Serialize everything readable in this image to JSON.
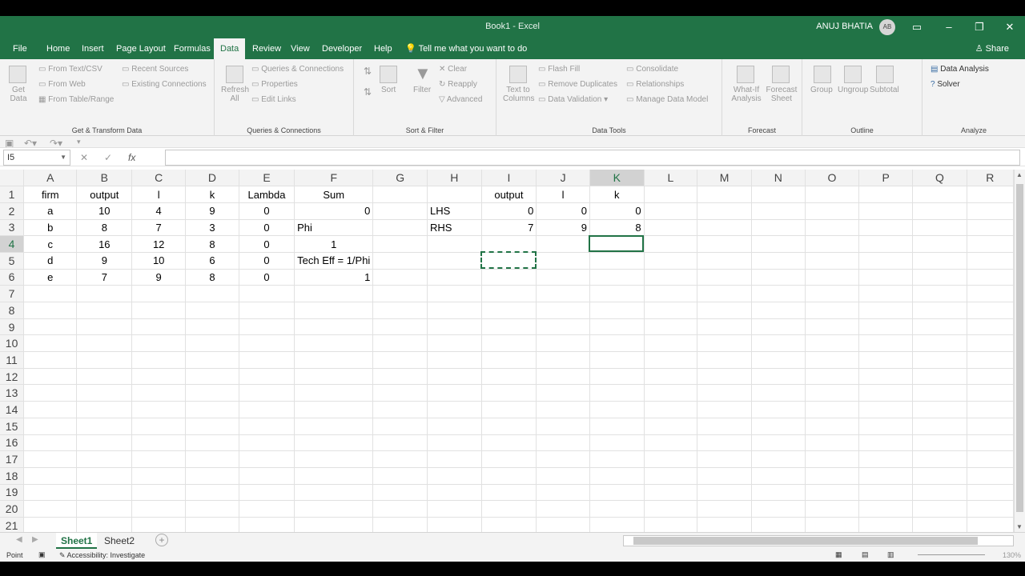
{
  "window": {
    "title": "Book1  -  Excel",
    "user": "ANUJ BHATIA",
    "avatar": "AB"
  },
  "tabs": [
    "File",
    "Home",
    "Insert",
    "Page Layout",
    "Formulas",
    "Data",
    "Review",
    "View",
    "Developer",
    "Help"
  ],
  "active_tab": "Data",
  "tell_me": "Tell me what you want to do",
  "share": "Share",
  "ribbon": {
    "get": {
      "label": "Get & Transform Data",
      "get_data": "Get Data",
      "from_text": "From Text/CSV",
      "from_web": "From Web",
      "from_table": "From Table/Range",
      "recent": "Recent Sources",
      "existing": "Existing Connections"
    },
    "queries": {
      "label": "Queries & Connections",
      "refresh": "Refresh All",
      "qc": "Queries & Connections",
      "props": "Properties",
      "edit": "Edit Links"
    },
    "sort": {
      "label": "Sort & Filter",
      "sort": "Sort",
      "filter": "Filter",
      "clear": "Clear",
      "reapply": "Reapply",
      "advanced": "Advanced"
    },
    "tools": {
      "label": "Data Tools",
      "ttc": "Text to Columns",
      "flash": "Flash Fill",
      "remove": "Remove Duplicates",
      "valid": "Data Validation",
      "consol": "Consolidate",
      "rel": "Relationships",
      "manage": "Manage Data Model"
    },
    "forecast": {
      "label": "Forecast",
      "whatif": "What-If Analysis",
      "sheet": "Forecast Sheet"
    },
    "outline": {
      "label": "Outline",
      "group": "Group",
      "ungroup": "Ungroup",
      "subtotal": "Subtotal"
    },
    "analyze": {
      "label": "Analyze",
      "da": "Data Analysis",
      "solver": "Solver"
    }
  },
  "namebox": "I5",
  "columns": [
    "A",
    "B",
    "C",
    "D",
    "E",
    "F",
    "G",
    "H",
    "I",
    "J",
    "K",
    "L",
    "M",
    "N",
    "O",
    "P",
    "Q",
    "R"
  ],
  "rows": [
    [
      "firm",
      "output",
      "l",
      "k",
      "Lambda",
      "Sum",
      "",
      "",
      "output",
      "l",
      "k",
      "",
      "",
      "",
      "",
      "",
      "",
      ""
    ],
    [
      "a",
      "10",
      "4",
      "9",
      "0",
      "0",
      "",
      "LHS",
      "0",
      "0",
      "0",
      "",
      "",
      "",
      "",
      "",
      "",
      ""
    ],
    [
      "b",
      "8",
      "7",
      "3",
      "0",
      "Phi",
      "",
      "RHS",
      "7",
      "9",
      "8",
      "",
      "",
      "",
      "",
      "",
      "",
      ""
    ],
    [
      "c",
      "16",
      "12",
      "8",
      "0",
      "1",
      "",
      "",
      "",
      "",
      "",
      "",
      "",
      "",
      "",
      "",
      "",
      ""
    ],
    [
      "d",
      "9",
      "10",
      "6",
      "0",
      "Tech Eff = 1/Phi",
      "",
      "",
      "",
      "",
      "",
      "",
      "",
      "",
      "",
      "",
      "",
      ""
    ],
    [
      "e",
      "7",
      "9",
      "8",
      "0",
      "1",
      "",
      "",
      "",
      "",
      "",
      "",
      "",
      "",
      "",
      "",
      "",
      ""
    ],
    [
      "",
      "",
      "",
      "",
      "",
      "",
      "",
      "",
      "",
      "",
      "",
      "",
      "",
      "",
      "",
      "",
      "",
      ""
    ],
    [
      "",
      "",
      "",
      "",
      "",
      "",
      "",
      "",
      "",
      "",
      "",
      "",
      "",
      "",
      "",
      "",
      "",
      ""
    ],
    [
      "",
      "",
      "",
      "",
      "",
      "",
      "",
      "",
      "",
      "",
      "",
      "",
      "",
      "",
      "",
      "",
      "",
      ""
    ],
    [
      "",
      "",
      "",
      "",
      "",
      "",
      "",
      "",
      "",
      "",
      "",
      "",
      "",
      "",
      "",
      "",
      "",
      ""
    ],
    [
      "",
      "",
      "",
      "",
      "",
      "",
      "",
      "",
      "",
      "",
      "",
      "",
      "",
      "",
      "",
      "",
      "",
      ""
    ],
    [
      "",
      "",
      "",
      "",
      "",
      "",
      "",
      "",
      "",
      "",
      "",
      "",
      "",
      "",
      "",
      "",
      "",
      ""
    ],
    [
      "",
      "",
      "",
      "",
      "",
      "",
      "",
      "",
      "",
      "",
      "",
      "",
      "",
      "",
      "",
      "",
      "",
      ""
    ],
    [
      "",
      "",
      "",
      "",
      "",
      "",
      "",
      "",
      "",
      "",
      "",
      "",
      "",
      "",
      "",
      "",
      "",
      ""
    ],
    [
      "",
      "",
      "",
      "",
      "",
      "",
      "",
      "",
      "",
      "",
      "",
      "",
      "",
      "",
      "",
      "",
      "",
      ""
    ],
    [
      "",
      "",
      "",
      "",
      "",
      "",
      "",
      "",
      "",
      "",
      "",
      "",
      "",
      "",
      "",
      "",
      "",
      ""
    ],
    [
      "",
      "",
      "",
      "",
      "",
      "",
      "",
      "",
      "",
      "",
      "",
      "",
      "",
      "",
      "",
      "",
      "",
      ""
    ],
    [
      "",
      "",
      "",
      "",
      "",
      "",
      "",
      "",
      "",
      "",
      "",
      "",
      "",
      "",
      "",
      "",
      "",
      ""
    ],
    [
      "",
      "",
      "",
      "",
      "",
      "",
      "",
      "",
      "",
      "",
      "",
      "",
      "",
      "",
      "",
      "",
      "",
      ""
    ],
    [
      "",
      "",
      "",
      "",
      "",
      "",
      "",
      "",
      "",
      "",
      "",
      "",
      "",
      "",
      "",
      "",
      "",
      ""
    ],
    [
      "",
      "",
      "",
      "",
      "",
      "",
      "",
      "",
      "",
      "",
      "",
      "",
      "",
      "",
      "",
      "",
      "",
      ""
    ]
  ],
  "sheets": [
    "Sheet1",
    "Sheet2"
  ],
  "active_sheet": "Sheet1",
  "status": {
    "mode": "Point",
    "accessibility": "Accessibility: Investigate",
    "zoom": "130%"
  },
  "colors": {
    "accent": "#217346"
  }
}
